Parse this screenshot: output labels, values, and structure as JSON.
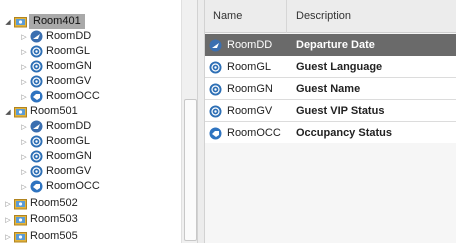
{
  "tree": {
    "items": [
      {
        "label": "Room401",
        "kind": "folder",
        "expanded": true,
        "selected": true
      },
      {
        "label": "RoomDD",
        "kind": "dd"
      },
      {
        "label": "RoomGL",
        "kind": "info"
      },
      {
        "label": "RoomGN",
        "kind": "info"
      },
      {
        "label": "RoomGV",
        "kind": "info"
      },
      {
        "label": "RoomOCC",
        "kind": "occ"
      },
      {
        "label": "Room501",
        "kind": "folder",
        "expanded": true
      },
      {
        "label": "RoomDD",
        "kind": "dd"
      },
      {
        "label": "RoomGL",
        "kind": "info"
      },
      {
        "label": "RoomGN",
        "kind": "info"
      },
      {
        "label": "RoomGV",
        "kind": "info"
      },
      {
        "label": "RoomOCC",
        "kind": "occ"
      },
      {
        "label": "Room502",
        "kind": "folder",
        "expanded": false
      },
      {
        "label": "Room503",
        "kind": "folder",
        "expanded": false
      },
      {
        "label": "Room505",
        "kind": "folder",
        "expanded": false
      }
    ]
  },
  "table": {
    "columns": {
      "name": "Name",
      "description": "Description"
    },
    "rows": [
      {
        "name": "RoomDD",
        "description": "Departure Date",
        "kind": "dd",
        "selected": true
      },
      {
        "name": "RoomGL",
        "description": "Guest Language",
        "kind": "info"
      },
      {
        "name": "RoomGN",
        "description": "Guest Name",
        "kind": "info"
      },
      {
        "name": "RoomGV",
        "description": "Guest VIP Status",
        "kind": "info"
      },
      {
        "name": "RoomOCC",
        "description": "Occupancy Status",
        "kind": "occ"
      }
    ]
  },
  "colors": {
    "tree_selection": "#a9a9a9",
    "row_selection": "#6a6a6a",
    "info_icon": "#2d6fb5",
    "folder_icon": "#e3b33b"
  }
}
